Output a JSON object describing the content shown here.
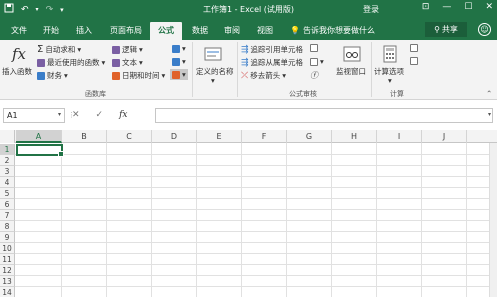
{
  "titlebar": {
    "title": "工作簿1 - Excel (试用版)",
    "login": "登录",
    "qat_save_icon": "save-icon",
    "qat_undo_icon": "undo-icon",
    "qat_redo_icon": "redo-icon"
  },
  "tabs": [
    "文件",
    "开始",
    "插入",
    "页面布局",
    "公式",
    "数据",
    "审阅",
    "视图"
  ],
  "active_tab": "公式",
  "tellme": "告诉我你想要做什么",
  "share": "共享",
  "ribbon": {
    "insert_function": "插入函数",
    "autosum": "自动求和",
    "recently_used": "最近使用的函数",
    "financial": "财务",
    "logical": "逻辑",
    "text": "文本",
    "datetime": "日期和时间",
    "function_library": "函数库",
    "defined_names": "定义的名称",
    "trace_precedents": "追踪引用单元格",
    "trace_dependents": "追踪从属单元格",
    "remove_arrows": "移去箭头",
    "formula_auditing": "公式审核",
    "watch_window": "监视窗口",
    "calc_options": "计算选项",
    "calculation": "计算"
  },
  "formula_bar": {
    "name_box": "A1",
    "cancel": "✕",
    "enter": "✓",
    "fx": "fx",
    "value": ""
  },
  "grid": {
    "columns": [
      "A",
      "B",
      "C",
      "D",
      "E",
      "F",
      "G",
      "H",
      "I",
      "J"
    ],
    "rows": [
      "1",
      "2",
      "3",
      "4",
      "5",
      "6",
      "7",
      "8",
      "9",
      "10",
      "11",
      "12",
      "13",
      "14"
    ],
    "selected_cell": "A1"
  },
  "colors": {
    "brand": "#217346",
    "ribbon_bg": "#f3f3f3"
  }
}
